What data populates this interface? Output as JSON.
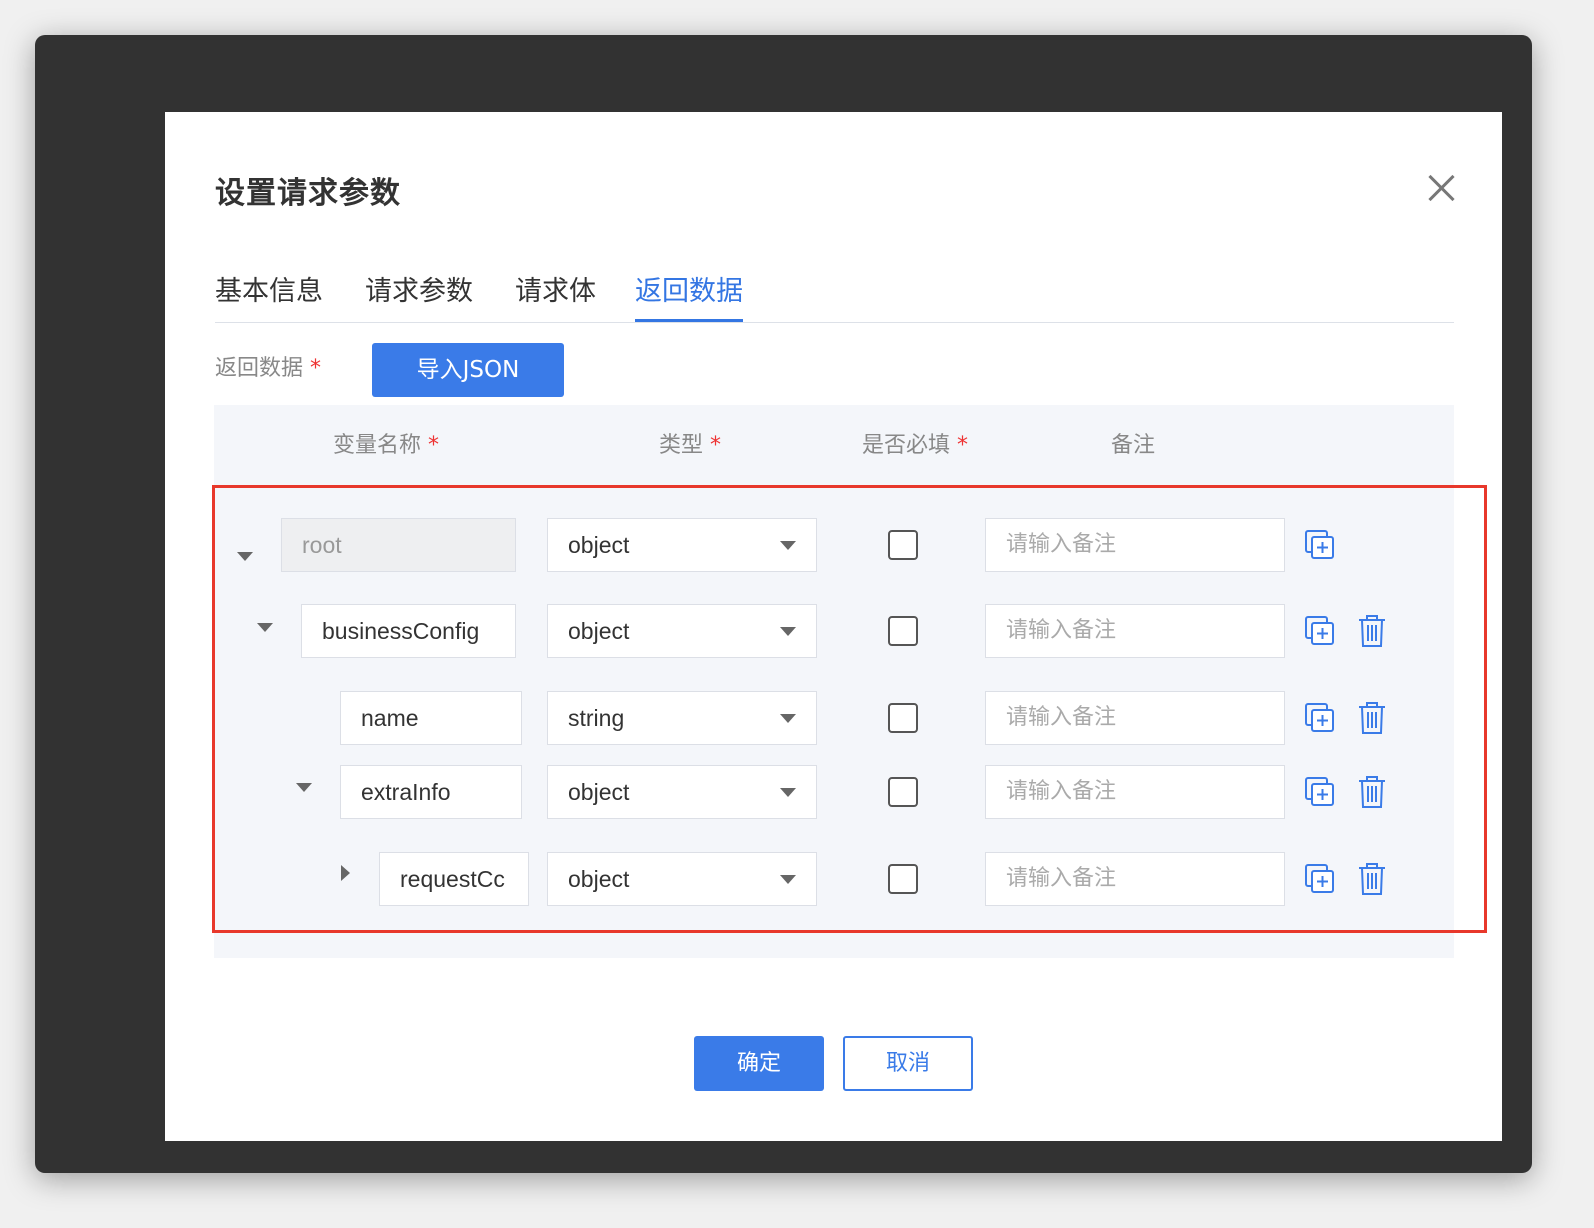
{
  "dialog": {
    "title": "设置请求参数"
  },
  "tabs": [
    {
      "label": "基本信息",
      "active": false
    },
    {
      "label": "请求参数",
      "active": false
    },
    {
      "label": "请求体",
      "active": false
    },
    {
      "label": "返回数据",
      "active": true
    }
  ],
  "section": {
    "label": "返回数据",
    "required_mark": "*",
    "import_button": "导入JSON"
  },
  "columns": {
    "name": "变量名称",
    "type": "类型",
    "required": "是否必填",
    "note": "备注",
    "required_mark": "*"
  },
  "rows": [
    {
      "name": "root",
      "type": "object",
      "required": false,
      "note_placeholder": "请输入备注",
      "expanded": true,
      "disabled": true
    },
    {
      "name": "businessConfig",
      "type": "object",
      "required": false,
      "note_placeholder": "请输入备注",
      "expanded": true
    },
    {
      "name": "name",
      "type": "string",
      "required": false,
      "note_placeholder": "请输入备注"
    },
    {
      "name": "extraInfo",
      "type": "object",
      "required": false,
      "note_placeholder": "请输入备注",
      "expanded": true
    },
    {
      "name": "requestCc",
      "type": "object",
      "required": false,
      "note_placeholder": "请输入备注",
      "expanded": false
    }
  ],
  "footer": {
    "ok_label": "确定",
    "cancel_label": "取消"
  },
  "colors": {
    "accent": "#3a7be8",
    "highlight_border": "#e8382b",
    "required_mark": "#e33"
  },
  "icons": [
    "close-icon",
    "caret-down-icon",
    "caret-right-icon",
    "chevron-down-icon",
    "add-child-icon",
    "trash-icon"
  ]
}
